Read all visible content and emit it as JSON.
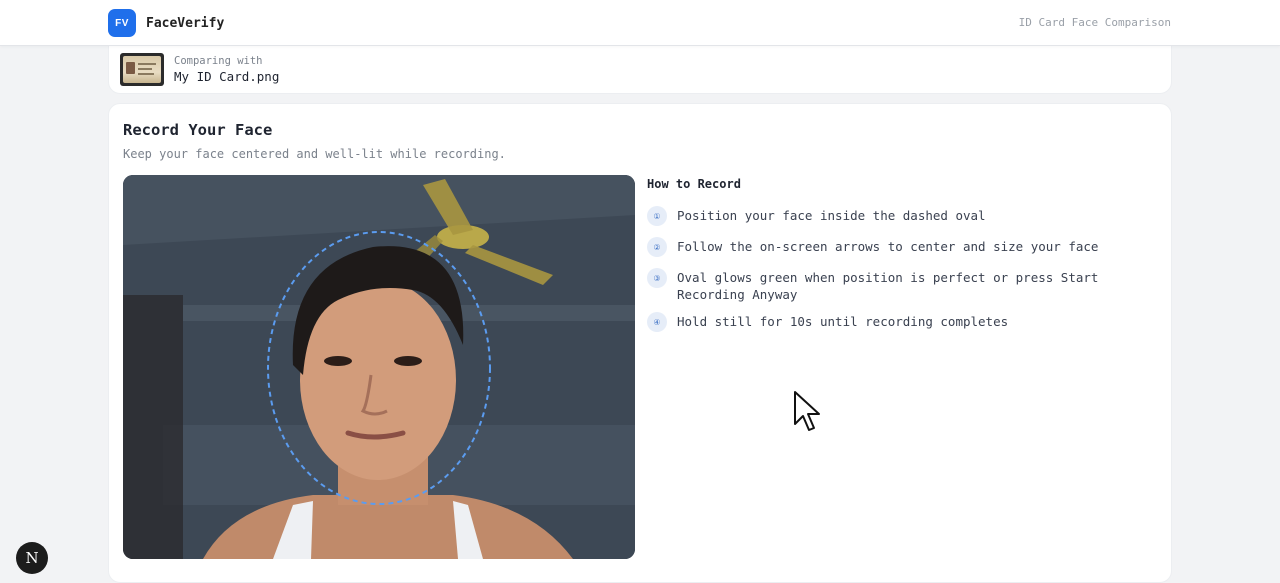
{
  "header": {
    "logo_text": "FV",
    "brand": "FaceVerify",
    "right_text": "ID Card Face Comparison"
  },
  "compare": {
    "label": "Comparing with",
    "file_name": "My ID Card.png"
  },
  "record": {
    "title": "Record Your Face",
    "subtitle": "Keep your face centered and well-lit while recording."
  },
  "instructions": {
    "title": "How to Record",
    "steps": [
      {
        "num": "①",
        "text": "Position your face inside the dashed oval"
      },
      {
        "num": "②",
        "text": "Follow the on-screen arrows to center and size your face"
      },
      {
        "num": "③",
        "text": "Oval glows green when position is perfect or press Start Recording Anyway"
      },
      {
        "num": "④",
        "text": "Hold still for 10s until recording completes"
      }
    ]
  },
  "dev_badge": "N",
  "colors": {
    "brand_blue": "#1f6feb",
    "oval_guide": "#5b9cf0",
    "step_badge_bg": "#e6edf8"
  },
  "icons": {
    "logo": "fv-logo-icon",
    "cursor": "mouse-pointer-icon",
    "dev": "nextjs-badge-icon"
  }
}
